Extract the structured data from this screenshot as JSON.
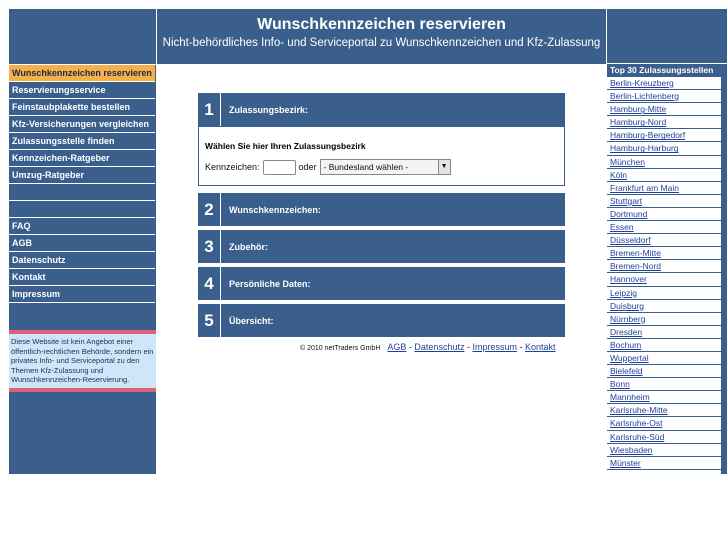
{
  "header": {
    "title": "Wunschkennzeichen reservieren",
    "subtitle": "Nicht-behördliches Info- und Serviceportal zu Wunschkennzeichen und Kfz-Zulassung"
  },
  "nav": {
    "primary": [
      "Wunschkennzeichen reservieren",
      "Reservierungsservice",
      "Feinstaubplakette bestellen",
      "Kfz-Versicherungen vergleichen",
      "Zulassungsstelle finden",
      "Kennzeichen-Ratgeber",
      "Umzug-Ratgeber"
    ],
    "secondary": [
      "FAQ",
      "AGB",
      "Datenschutz",
      "Kontakt",
      "Impressum"
    ]
  },
  "notice": "Diese Website ist kein Angebot einer öffentlich-rechtlichen Behörde, sondern ein privates Info- und Serviceportal zu den Themen Kfz-Zulassung und Wunschkennzeichen-Reservierung.",
  "steps": [
    {
      "num": "1",
      "title": "Zulassungsbezirk:"
    },
    {
      "num": "2",
      "title": "Wunschkennzeichen:"
    },
    {
      "num": "3",
      "title": "Zubehör:"
    },
    {
      "num": "4",
      "title": "Persönliche Daten:"
    },
    {
      "num": "5",
      "title": "Übersicht:"
    }
  ],
  "step1": {
    "heading": "Wählen Sie hier Ihren Zulassungsbezirk",
    "kennzeichen_label": "Kennzeichen:",
    "kennzeichen_value": "",
    "oder_label": "oder",
    "bundesland_selected": "- Bundesland wählen -"
  },
  "footer": {
    "copyright": "© 2010 netTraders GmbH",
    "links": [
      "AGB",
      "Datenschutz",
      "Impressum",
      "Kontakt"
    ]
  },
  "cities": {
    "heading": "Top 30 Zulassungsstellen",
    "items": [
      "Berlin-Kreuzberg",
      "Berlin-Lichtenberg",
      "Hamburg-Mitte",
      "Hamburg-Nord",
      "Hamburg-Bergedorf",
      "Hamburg-Harburg",
      "München",
      "Köln",
      "Frankfurt am Main",
      "Stuttgart",
      "Dortmund",
      "Essen",
      "Düsseldorf",
      "Bremen-Mitte",
      "Bremen-Nord",
      "Hannover",
      "Leipzig",
      "Duisburg",
      "Nürnberg",
      "Dresden",
      "Bochum",
      "Wuppertal",
      "Bielefeld",
      "Bonn",
      "Mannheim",
      "Karlsruhe-Mitte",
      "Karlsruhe-Ost",
      "Karlsruhe-Süd",
      "Wiesbaden",
      "Münster"
    ]
  },
  "colors": {
    "primary": "#3a5f8c",
    "active_nav": "#f5b04a",
    "notice_bg": "#cfe6f9",
    "notice_border": "#e0607a",
    "link": "#1f3f9a"
  }
}
